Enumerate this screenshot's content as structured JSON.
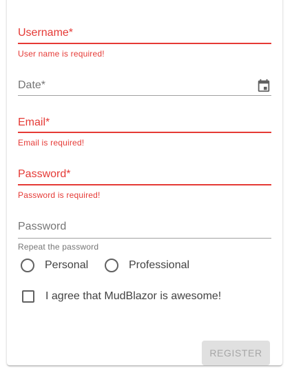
{
  "form": {
    "username": {
      "label": "Username*",
      "helper": "User name is required!"
    },
    "date": {
      "label": "Date*",
      "icon": "calendar-icon"
    },
    "email": {
      "label": "Email*",
      "helper": "Email is required!"
    },
    "password": {
      "label": "Password*",
      "helper": "Password is required!"
    },
    "repeat_password": {
      "label": "Password",
      "helper": "Repeat the password"
    },
    "account_type": {
      "options": [
        "Personal",
        "Professional"
      ]
    },
    "agree": {
      "label": "I agree that MudBlazor is awesome!"
    },
    "register_label": "REGISTER"
  },
  "colors": {
    "error": "#e53935",
    "text": "#424242",
    "muted": "#757575",
    "disabled_button_bg": "#e0e0e0",
    "disabled_button_text": "#a6a6a6"
  }
}
